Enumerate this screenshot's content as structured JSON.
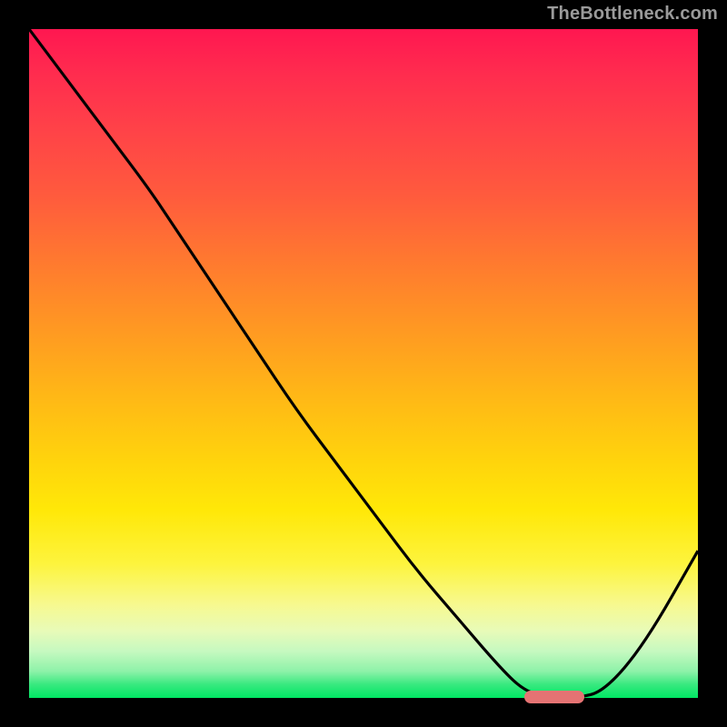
{
  "watermark": "TheBottleneck.com",
  "colors": {
    "curve_stroke": "#000000",
    "marker_fill": "#e57373",
    "frame_bg": "#000000"
  },
  "chart_data": {
    "type": "line",
    "title": "",
    "xlabel": "",
    "ylabel": "",
    "xlim": [
      0,
      100
    ],
    "ylim": [
      0,
      100
    ],
    "x": [
      0,
      6,
      12,
      18,
      22,
      28,
      34,
      40,
      46,
      52,
      58,
      64,
      70,
      74,
      78,
      82,
      86,
      92,
      100
    ],
    "y": [
      100,
      92,
      84,
      76,
      70,
      61,
      52,
      43,
      35,
      27,
      19,
      12,
      5,
      1,
      0,
      0,
      1,
      8,
      22
    ],
    "marker": {
      "x_start": 74,
      "x_end": 83,
      "y": 0
    },
    "gradient_stops": [
      {
        "pos": 0.0,
        "color": "#ff1750"
      },
      {
        "pos": 0.35,
        "color": "#ff7a2f"
      },
      {
        "pos": 0.65,
        "color": "#ffd50c"
      },
      {
        "pos": 0.9,
        "color": "#e8fbb8"
      },
      {
        "pos": 1.0,
        "color": "#00e763"
      }
    ]
  }
}
